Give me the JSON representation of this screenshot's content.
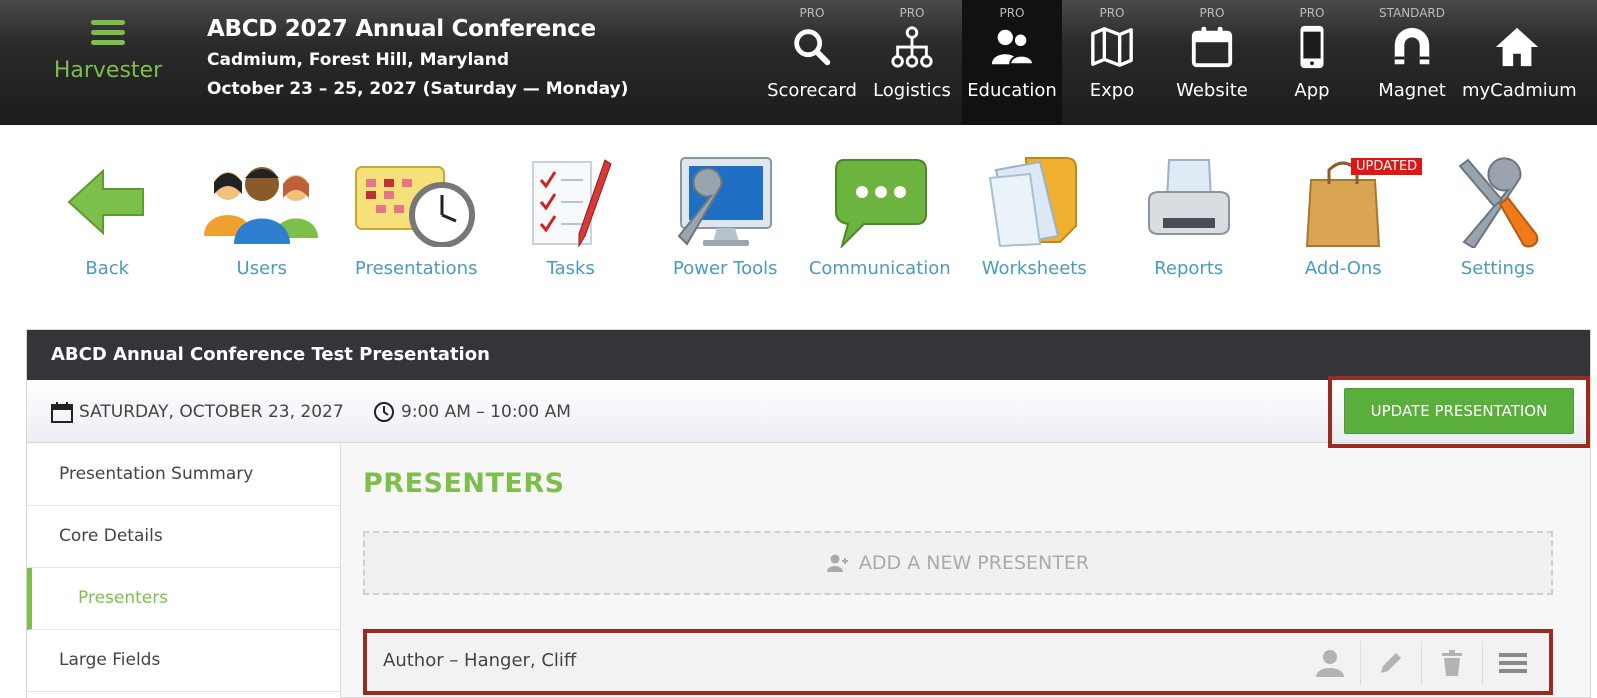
{
  "topbar": {
    "brand": "Harvester",
    "event_title": "ABCD 2027 Annual Conference",
    "event_location": "Cadmium, Forest Hill, Maryland",
    "event_dates": "October 23 – 25, 2027 (Saturday — Monday)",
    "modules": [
      {
        "tier": "PRO",
        "label": "Scorecard",
        "icon": "search-icon"
      },
      {
        "tier": "PRO",
        "label": "Logistics",
        "icon": "hierarchy-icon"
      },
      {
        "tier": "PRO",
        "label": "Education",
        "icon": "users-icon",
        "active": true
      },
      {
        "tier": "PRO",
        "label": "Expo",
        "icon": "map-icon"
      },
      {
        "tier": "PRO",
        "label": "Website",
        "icon": "calendar-icon"
      },
      {
        "tier": "PRO",
        "label": "App",
        "icon": "phone-icon"
      },
      {
        "tier": "STANDARD",
        "label": "Magnet",
        "icon": "magnet-icon"
      },
      {
        "tier": "",
        "label": "myCadmium",
        "icon": "home-icon"
      }
    ]
  },
  "toolbar": {
    "items": [
      {
        "label": "Back",
        "icon": "back-arrow-icon"
      },
      {
        "label": "Users",
        "icon": "people-icon"
      },
      {
        "label": "Presentations",
        "icon": "calendar-clock-icon"
      },
      {
        "label": "Tasks",
        "icon": "checklist-icon"
      },
      {
        "label": "Power Tools",
        "icon": "monitor-wrench-icon"
      },
      {
        "label": "Communication",
        "icon": "chat-bubble-icon"
      },
      {
        "label": "Worksheets",
        "icon": "folder-icon"
      },
      {
        "label": "Reports",
        "icon": "printer-icon"
      },
      {
        "label": "Add-Ons",
        "icon": "shopping-bag-icon",
        "badge": "UPDATED"
      },
      {
        "label": "Settings",
        "icon": "tools-icon"
      }
    ]
  },
  "panel": {
    "title": "ABCD Annual Conference Test Presentation",
    "date": "SATURDAY, OCTOBER 23, 2027",
    "time": "9:00 AM – 10:00 AM",
    "update_button": "UPDATE PRESENTATION",
    "sidebar": [
      {
        "label": "Presentation Summary"
      },
      {
        "label": "Core Details"
      },
      {
        "label": "Presenters",
        "active": true
      },
      {
        "label": "Large Fields"
      }
    ],
    "section_title": "PRESENTERS",
    "add_presenter": "ADD A NEW PRESENTER",
    "presenters": [
      {
        "name": "Author – Hanger, Cliff"
      }
    ]
  },
  "colors": {
    "accent_green": "#7cbf4a",
    "button_green": "#5aaf3c",
    "link_blue": "#4a9bbd",
    "highlight_red": "#9b2a1f",
    "badge_red": "#e01616"
  }
}
